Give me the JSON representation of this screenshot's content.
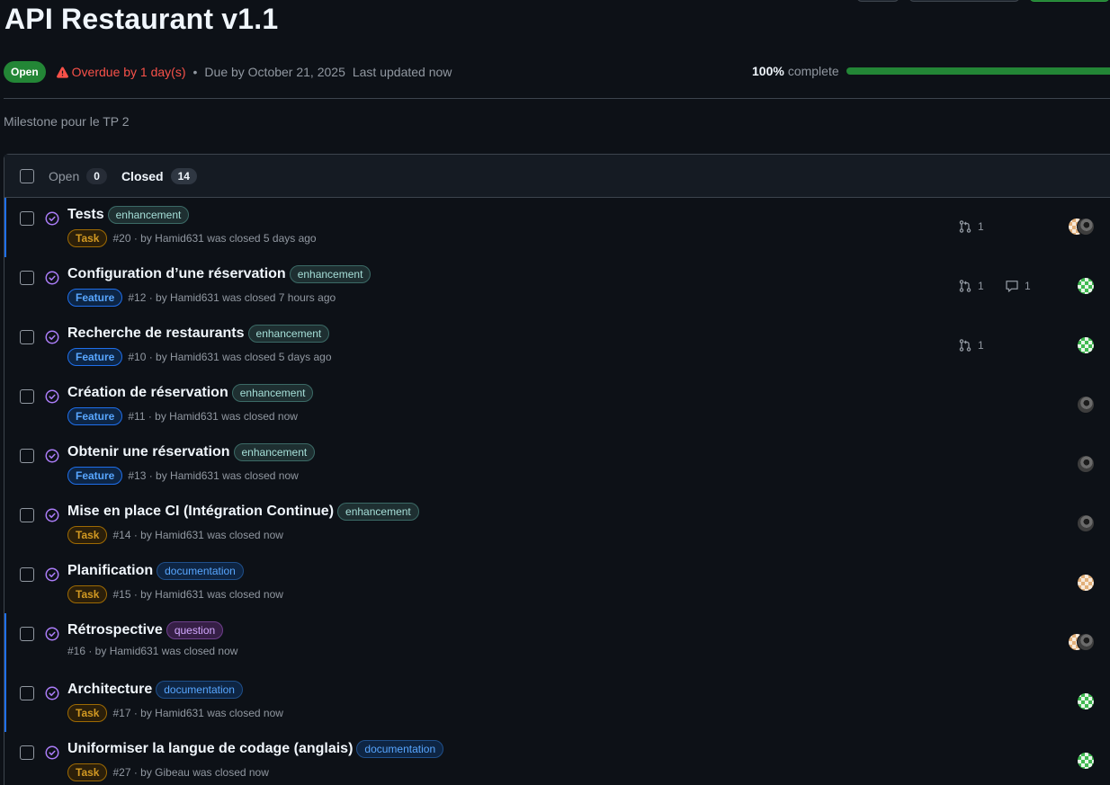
{
  "milestone": {
    "title": "API Restaurant v1.1",
    "state": "Open",
    "overdue": "Overdue by 1 day(s)",
    "separator": "•",
    "due": "Due by October 21, 2025",
    "updated": "Last updated now",
    "progress_percent": "100%",
    "progress_label": "complete",
    "progress_value": 1.0,
    "description": "Milestone pour le TP 2"
  },
  "tabs": {
    "open_label": "Open",
    "open_count": "0",
    "closed_label": "Closed",
    "closed_count": "14"
  },
  "issues": [
    {
      "title": "Tests",
      "label": "enhancement",
      "type": "Task",
      "meta": "#20 · by Hamid631 was closed 5 days ago",
      "prs": "1"
    },
    {
      "title": "Configuration d’une réservation",
      "label": "enhancement",
      "type": "Feature",
      "meta": "#12 · by Hamid631 was closed 7 hours ago",
      "prs": "1",
      "comments": "1"
    },
    {
      "title": "Recherche de restaurants",
      "label": "enhancement",
      "type": "Feature",
      "meta": "#10 · by Hamid631 was closed 5 days ago",
      "prs": "1"
    },
    {
      "title": "Création de réservation",
      "label": "enhancement",
      "type": "Feature",
      "meta": "#11 · by Hamid631 was closed now"
    },
    {
      "title": "Obtenir une réservation",
      "label": "enhancement",
      "type": "Feature",
      "meta": "#13 · by Hamid631 was closed now"
    },
    {
      "title": "Mise en place CI (Intégration Continue)",
      "label": "enhancement",
      "type": "Task",
      "meta": "#14 · by Hamid631 was closed now"
    },
    {
      "title": "Planification",
      "label": "documentation",
      "type": "Task",
      "meta": "#15 · by Hamid631 was closed now"
    },
    {
      "title": "Rétrospective",
      "label": "question",
      "meta": "#16 · by Hamid631 was closed now"
    },
    {
      "title": "Architecture",
      "label": "documentation",
      "type": "Task",
      "meta": "#17 · by Hamid631 was closed now"
    },
    {
      "title": "Uniformiser la langue de codage (anglais)",
      "label": "documentation",
      "type": "Task",
      "meta": "#27 · by Gibeau was closed now"
    }
  ]
}
